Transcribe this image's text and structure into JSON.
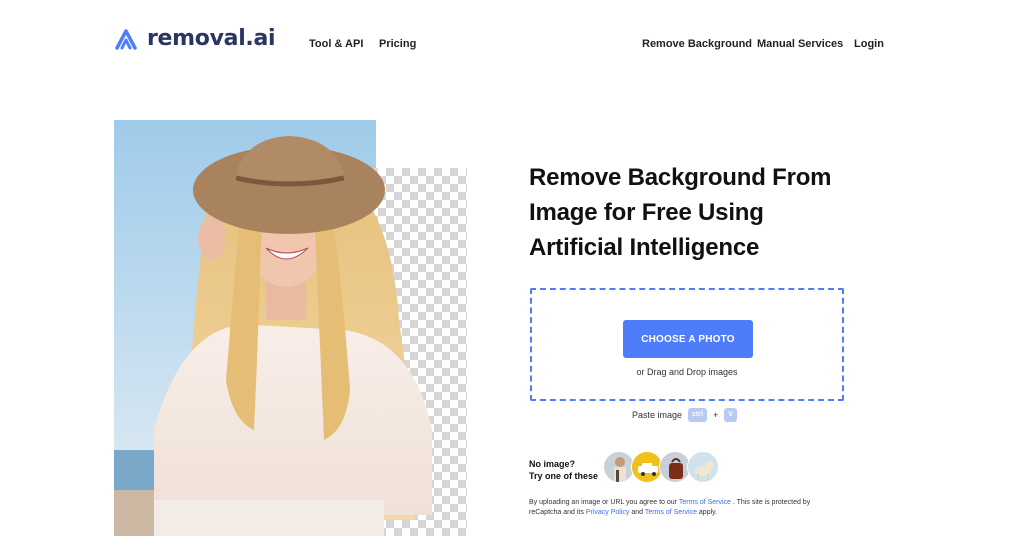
{
  "header": {
    "logo_text": "removal.ai",
    "nav_left": [
      "Tool & API",
      "Pricing"
    ],
    "nav_right": [
      "Remove Background",
      "Manual Services",
      "Login"
    ]
  },
  "hero": {
    "headline": "Remove Background From Image for Free Using Artificial Intelligence"
  },
  "upload": {
    "button_label": "CHOOSE A PHOTO",
    "drag_text": "or Drag and Drop images",
    "paste_label": "Paste image",
    "key_ctrl": "ctrl",
    "key_plus": "+",
    "key_v": "V"
  },
  "samples": {
    "prompt_line1": "No image?",
    "prompt_line2": "Try one of these"
  },
  "legal": {
    "part1": "By uploading an image or URL you agree to our ",
    "terms_link": "Terms of Service",
    "part2": " . This site is protected by reCaptcha and its ",
    "privacy_link": "Privacy Policy",
    "part3": " and ",
    "terms_link2": "Terms of Service",
    "part4": " apply."
  },
  "colors": {
    "accent": "#4f7df9",
    "logo_text": "#2a3561",
    "link": "#3b6ef5"
  }
}
